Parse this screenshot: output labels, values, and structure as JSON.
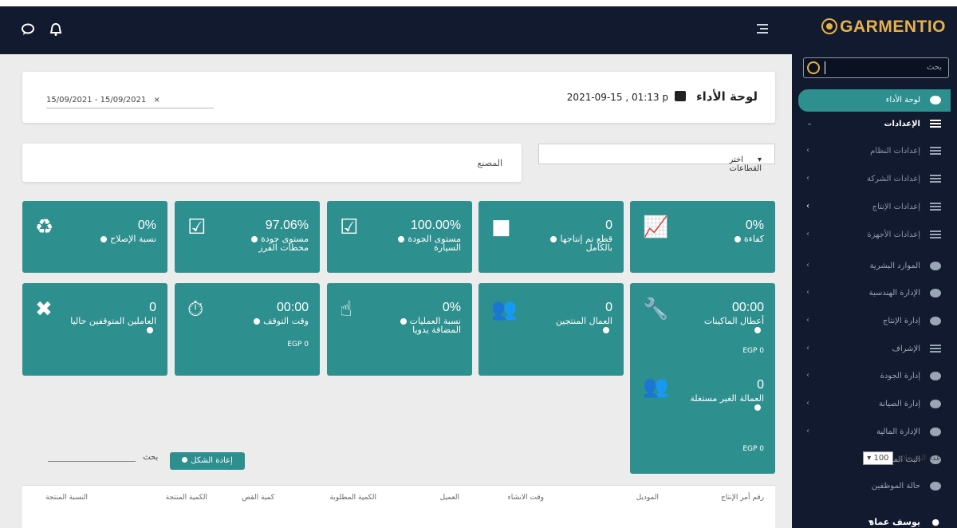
{
  "topbar": {
    "chat_icon": "chat-icon",
    "bell_icon": "bell-icon",
    "menu_icon": "hamburger-icon"
  },
  "brand": {
    "name": "GARMENTIO",
    "color": "#e7b14a"
  },
  "sidebar": {
    "search_placeholder": "بحث",
    "items": [
      {
        "label": "لوحة الأداء",
        "icon": "dashboard-icon",
        "state": "active"
      },
      {
        "label": "الإعدادات",
        "icon": "settings-icon",
        "state": "expanded"
      },
      {
        "label": "إعدادات النظام",
        "icon": "list-icon",
        "state": "sub"
      },
      {
        "label": "إعدادات الشركة",
        "icon": "list-icon",
        "state": "sub"
      },
      {
        "label": "إعدادات الإنتاج",
        "icon": "list-icon",
        "state": "sub"
      },
      {
        "label": "إعدادات الأجهزة",
        "icon": "list-icon",
        "state": "sub"
      },
      {
        "label": "الموارد البشرية",
        "icon": "users-icon",
        "state": "collapsed"
      },
      {
        "label": "الإدارة الهندسية",
        "icon": "building-icon",
        "state": "collapsed"
      },
      {
        "label": "إدارة الإنتاج",
        "icon": "cart-icon",
        "state": "collapsed"
      },
      {
        "label": "الإشراف",
        "icon": "list-icon",
        "state": "collapsed"
      },
      {
        "label": "إدارة الجودة",
        "icon": "clipboard-icon",
        "state": "collapsed"
      },
      {
        "label": "إدارة الصيانة",
        "icon": "tools-icon",
        "state": "collapsed"
      },
      {
        "label": "الإدارة المالية",
        "icon": "money-icon",
        "state": "collapsed"
      },
      {
        "label": "البث المباشر",
        "icon": "rss-icon",
        "state": "leaf"
      },
      {
        "label": "حالة الموظفين",
        "icon": "chart-icon",
        "state": "leaf"
      }
    ],
    "user": "يوسف عماد"
  },
  "header": {
    "title": "لوحة الأداء",
    "timestamp": "2021-09-15 , 01:13 p",
    "date_range": "15/09/2021 - 15/09/2021"
  },
  "filters": {
    "sector_placeholder": "اختر القطاعات",
    "factory_label": "المصنع"
  },
  "kpis": [
    {
      "value": "0%",
      "label": "كفاءة",
      "icon": "line-chart-icon",
      "egp": ""
    },
    {
      "value": "0",
      "label": "قطع تم إنتاجها بالكامل",
      "icon": "box-icon",
      "egp": ""
    },
    {
      "value": "100.00%",
      "label": "مستوى الجودة السيارة",
      "icon": "clipboard-check-icon",
      "egp": ""
    },
    {
      "value": "97.06%",
      "label": "مستوى جودة محطات الفرز",
      "icon": "clipboard-check-icon",
      "egp": ""
    },
    {
      "value": "0%",
      "label": "نسبة الإصلاح",
      "icon": "recycle-icon",
      "egp": ""
    },
    {
      "value": "00:00",
      "label": "أعطال الماكينات",
      "icon": "wrench-icon",
      "egp": "EGP 0"
    },
    {
      "value": "0",
      "label": "العمال المنتجين",
      "icon": "users-icon",
      "egp": ""
    },
    {
      "value": "0%",
      "label": "نسبة العمليات المضافة يدويا",
      "icon": "hand-pointer-icon",
      "egp": ""
    },
    {
      "value": "00:00",
      "label": "وقت التوقف",
      "icon": "user-clock-icon",
      "egp": "EGP 0"
    },
    {
      "value": "0",
      "label": "العاملين المتوقفين حاليا",
      "icon": "user-times-icon",
      "egp": ""
    },
    {
      "value": "0",
      "label": "العمالة الغير مستغلة",
      "icon": "users-icon",
      "egp": "EGP 0"
    }
  ],
  "table": {
    "entries_label": "عدد المدخلات",
    "entries_value": "100",
    "search_label": "بحث",
    "reset_label": "إعادة الشكل",
    "columns": [
      "رقم أمر الإنتاج",
      "الموديل",
      "وقت الانشاء",
      "العميل",
      "الكمية المطلوبة",
      "كمية القص",
      "الكمية المنتجة",
      "النسبة المنتجة"
    ]
  },
  "colors": {
    "accent": "#2e8f8f",
    "navy": "#111a2e",
    "brand": "#e7b14a"
  }
}
